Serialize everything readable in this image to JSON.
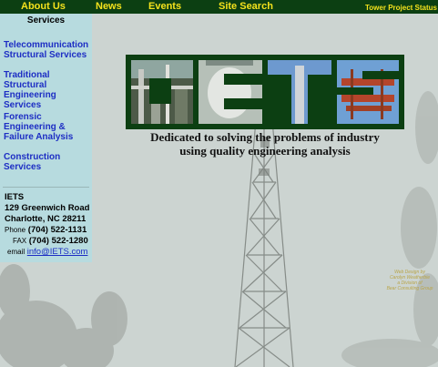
{
  "nav": {
    "items": [
      "About Us",
      "News",
      "Events",
      "Site Search"
    ],
    "status_link": "Tower Project Status"
  },
  "sidebar": {
    "heading": "Services",
    "links": [
      {
        "lines": [
          "Telecommunication",
          "Structural Services"
        ]
      },
      {
        "lines": [
          "Traditional Structural",
          "Engineering",
          "Services"
        ]
      },
      {
        "lines": [
          "Forensic",
          "Engineering &",
          "Failure Analysis"
        ]
      },
      {
        "lines": [
          "Construction",
          "Services"
        ]
      }
    ],
    "address": {
      "company": "IETS",
      "street": "129 Greenwich Road",
      "city": "Charlotte, NC  28211",
      "phone_label": "Phone",
      "phone": "(704) 522-1131",
      "fax_label": "FAX",
      "fax": "(704) 522-1280",
      "email_label": "email",
      "email": "info@IETS.com"
    }
  },
  "banner": {
    "letters": [
      "I",
      "E",
      "T",
      "S"
    ],
    "tagline": [
      "Dedicated to solving the problems of industry",
      "using quality engineering analysis"
    ]
  },
  "credit": [
    "Web Design by",
    "Carolyn Weatherbie",
    "a Division of",
    "Bear Consulting Group"
  ],
  "colors": {
    "nav_bg": "#0c3f12",
    "nav_text": "#f4e21c",
    "link": "#1d2ec4",
    "sidebar_bg": "#afdee4"
  }
}
